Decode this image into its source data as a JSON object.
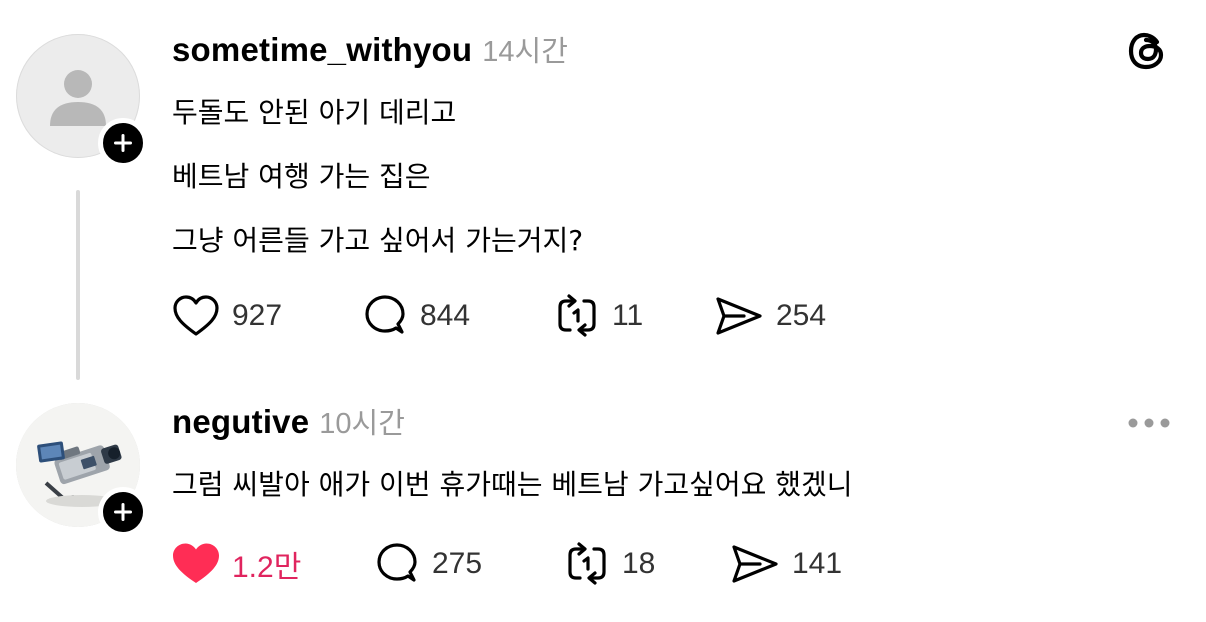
{
  "posts": [
    {
      "username": "sometime_withyou",
      "timestamp": "14시간",
      "lines": [
        "두돌도 안된 아기 데리고",
        "베트남 여행 가는 집은",
        "그냥 어른들 가고 싶어서 가는거지?"
      ],
      "likes": "927",
      "replies": "844",
      "reposts": "11",
      "shares": "254",
      "liked": false
    },
    {
      "username": "negutive",
      "timestamp": "10시간",
      "lines": [
        "그럼 씨발아 애가 이번 휴가때는 베트남 가고싶어요 했겠니"
      ],
      "likes": "1.2만",
      "replies": "275",
      "reposts": "18",
      "shares": "141",
      "liked": true
    }
  ],
  "icons": {
    "corner_post_1": "threads-logo-icon",
    "corner_post_2": "more-options-icon",
    "avatar_post_1": "default-user-icon",
    "avatar_post_2": "camcorder-photo",
    "badge": "plus-icon"
  },
  "colors": {
    "like_active": "#e0245e",
    "text_primary": "#000000",
    "text_secondary": "#9a9a9a",
    "thread_line": "#d9d9d9"
  }
}
